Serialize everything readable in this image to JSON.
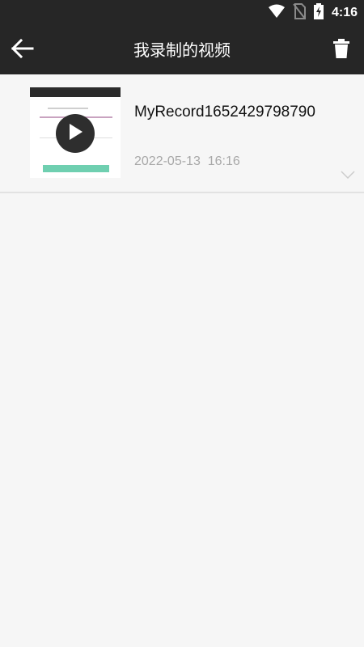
{
  "status_bar": {
    "time": "4:16",
    "icons": [
      "wifi-icon",
      "no-sim-icon",
      "battery-charging-icon"
    ]
  },
  "app_bar": {
    "title": "我录制的视频",
    "back_icon": "arrow-left-icon",
    "delete_icon": "trash-icon"
  },
  "videos": [
    {
      "name": "MyRecord1652429798790",
      "date": "2022-05-13  16:16",
      "play_icon": "play-icon",
      "expand_icon": "chevron-down-icon"
    }
  ],
  "colors": {
    "app_bar": "#262626",
    "background": "#f6f6f6",
    "date_text": "#a8a8a8"
  }
}
